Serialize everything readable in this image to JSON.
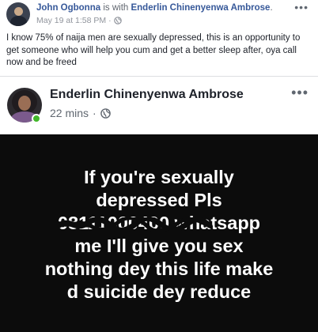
{
  "post1": {
    "author": "John Ogbonna",
    "with_text": " is with ",
    "tagged": "Enderlin Chinenyenwa Ambrose",
    "tagged_suffix": ".",
    "timestamp": "May 19 at 1:58 PM",
    "separator": "·",
    "privacy_icon": "globe-icon",
    "more_label": "•••",
    "body": "I know 75% of naija men are sexually depressed, this is an opportunity to get someone who will help you cum and get a better sleep after, oya call now and be freed"
  },
  "post2": {
    "author": "Enderlin Chinenyenwa Ambrose",
    "timestamp": "22 mins",
    "separator": "·",
    "privacy_icon": "globe-icon",
    "more_label": "•••",
    "online": true,
    "online_color": "#42b72a",
    "image_text": {
      "line1": "If you're sexually",
      "line2": "depressed Pls",
      "phone_number": "08111000400",
      "line3_rest": " whatsapp",
      "line4": "me I'll give you sex",
      "line5": "nothing dey this life make",
      "line6": "d suicide dey reduce"
    }
  },
  "colors": {
    "link": "#365899",
    "meta": "#90949c",
    "text": "#1d2129",
    "image_bg": "#0c0c0c",
    "page_bg": "#e9ebee"
  }
}
